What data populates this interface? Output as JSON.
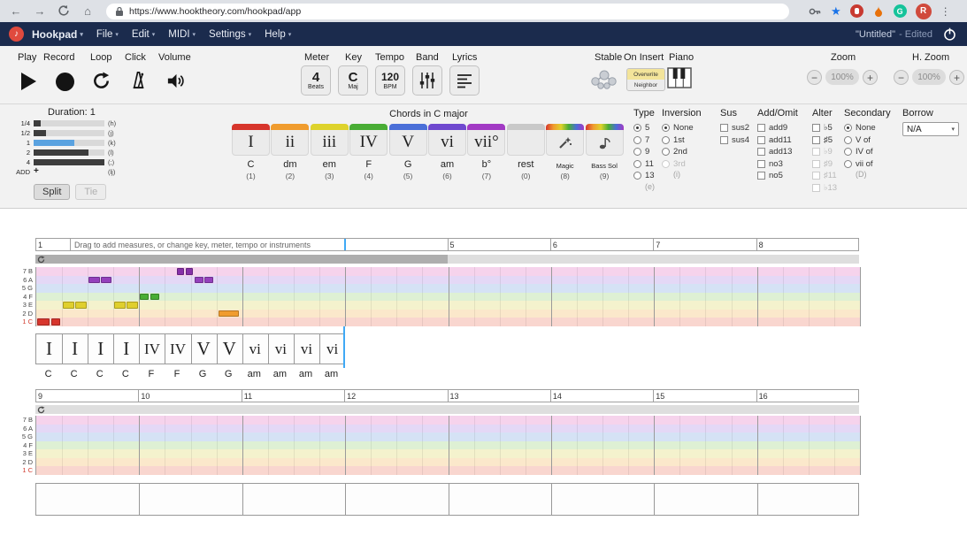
{
  "browser": {
    "url": "https://www.hooktheory.com/hookpad/app",
    "avatar_letter": "R",
    "bookmark_color": "#1a73e8"
  },
  "header": {
    "menus": [
      "Hookpad",
      "File",
      "Edit",
      "MIDI",
      "Settings",
      "Help"
    ],
    "doc_title": "\"Untitled\"",
    "doc_status": "- Edited"
  },
  "transport": {
    "play": "Play",
    "record": "Record",
    "loop": "Loop",
    "click": "Click",
    "volume": "Volume"
  },
  "settings": {
    "meter": {
      "label": "Meter",
      "value": "4",
      "unit": "Beats"
    },
    "key": {
      "label": "Key",
      "value": "C",
      "unit": "Maj"
    },
    "tempo": {
      "label": "Tempo",
      "value": "120",
      "unit": "BPM"
    },
    "band": {
      "label": "Band"
    },
    "lyrics": {
      "label": "Lyrics"
    },
    "stable": {
      "label": "Stable"
    },
    "on_insert": {
      "label": "On Insert",
      "options": [
        "Overwrite",
        "Neighbor"
      ],
      "selected": "Overwrite"
    },
    "piano": {
      "label": "Piano"
    },
    "zoom": {
      "label": "Zoom",
      "value": "100%"
    },
    "h_zoom": {
      "label": "H. Zoom",
      "value": "100%"
    }
  },
  "duration": {
    "title": "Duration: 1",
    "selected_color": "#5aa2e0",
    "bar_color": "#3d3d3d",
    "rows": [
      {
        "label": "1/4",
        "key": "(h)",
        "fill": 8
      },
      {
        "label": "1/2",
        "key": "(j)",
        "fill": 14
      },
      {
        "label": "1",
        "key": "(k)",
        "fill": 46,
        "selected": true
      },
      {
        "label": "2",
        "key": "(l)",
        "fill": 62
      },
      {
        "label": "4",
        "key": "(;)",
        "fill": 80
      },
      {
        "label": "ADD",
        "key": "(lj)",
        "fill": 0,
        "add": true
      }
    ],
    "split": "Split",
    "tie": "Tie"
  },
  "palette": {
    "title": "Chords in C major",
    "chords": [
      {
        "numeral": "I",
        "name": "C",
        "num": "(1)",
        "color": "#d7352c"
      },
      {
        "numeral": "ii",
        "name": "dm",
        "num": "(2)",
        "color": "#f09c2e"
      },
      {
        "numeral": "iii",
        "name": "em",
        "num": "(3)",
        "color": "#ded32c"
      },
      {
        "numeral": "IV",
        "name": "F",
        "num": "(4)",
        "color": "#49ad35"
      },
      {
        "numeral": "V",
        "name": "G",
        "num": "(5)",
        "color": "#4a6fd8"
      },
      {
        "numeral": "vi",
        "name": "am",
        "num": "(6)",
        "color": "#6f49cf"
      },
      {
        "numeral": "vii°",
        "name": "b°",
        "num": "(7)",
        "color": "#a23ac4"
      },
      {
        "numeral": "",
        "name": "rest",
        "num": "(0)",
        "color": "#c9c9c9"
      },
      {
        "numeral": "",
        "name": "Magic",
        "num": "(8)",
        "color": "rainbow",
        "icon": "magic"
      },
      {
        "numeral": "",
        "name": "Bass Sol",
        "num": "(9)",
        "color": "rainbow",
        "icon": "bass"
      }
    ]
  },
  "options": {
    "type": {
      "label": "Type",
      "hint": "(e)",
      "items": [
        {
          "t": "5",
          "sel": true
        },
        {
          "t": "7"
        },
        {
          "t": "9"
        },
        {
          "t": "11"
        },
        {
          "t": "13"
        }
      ]
    },
    "inversion": {
      "label": "Inversion",
      "hint": "(i)",
      "items": [
        {
          "t": "None",
          "sel": true
        },
        {
          "t": "1st"
        },
        {
          "t": "2nd"
        },
        {
          "t": "3rd",
          "dis": true
        }
      ]
    },
    "sus": {
      "label": "Sus",
      "items": [
        {
          "t": "sus2"
        },
        {
          "t": "sus4"
        }
      ]
    },
    "add_omit": {
      "label": "Add/Omit",
      "items": [
        {
          "t": "add9"
        },
        {
          "t": "add11"
        },
        {
          "t": "add13"
        },
        {
          "t": "no3"
        },
        {
          "t": "no5"
        }
      ]
    },
    "alter": {
      "label": "Alter",
      "items": [
        {
          "t": "♭5"
        },
        {
          "t": "♯5"
        },
        {
          "t": "♭9",
          "dis": true
        },
        {
          "t": "♯9",
          "dis": true
        },
        {
          "t": "♯11",
          "dis": true
        },
        {
          "t": "♭13",
          "dis": true
        }
      ]
    },
    "secondary": {
      "label": "Secondary",
      "hint": "(D)",
      "items": [
        {
          "t": "None",
          "sel": true
        },
        {
          "t": "V of"
        },
        {
          "t": "IV of"
        },
        {
          "t": "vii of"
        }
      ]
    },
    "borrow": {
      "label": "Borrow",
      "value": "N/A"
    }
  },
  "score": {
    "hint": "Drag to add measures, or change key, meter, tempo or instruments",
    "row_labels": [
      "7 B",
      "6 A",
      "5 G",
      "4 F",
      "3 E",
      "2 D",
      "1 C"
    ],
    "row_colors": [
      "#f6d3ec",
      "#e4d8f6",
      "#d5e2f5",
      "#def0d4",
      "#f4f2cd",
      "#fbe8cb",
      "#f9d6cf"
    ],
    "degree_colors": {
      "1": "#d7352c",
      "2": "#f09c2e",
      "3": "#e0cf2e",
      "4": "#49ad35",
      "5": "#4a6fd8",
      "6": "#9440bc",
      "7": "#8731a8"
    },
    "cursor_color": "#3fa9f5",
    "system1": {
      "numbers": [
        [
          "1",
          0
        ],
        [
          "5",
          4
        ],
        [
          "6",
          5
        ],
        [
          "7",
          6
        ],
        [
          "8",
          7
        ]
      ]
    },
    "system2": {
      "numbers": [
        [
          "9",
          0
        ],
        [
          "10",
          1
        ],
        [
          "11",
          2
        ],
        [
          "12",
          3
        ],
        [
          "13",
          4
        ],
        [
          "14",
          5
        ],
        [
          "15",
          6
        ],
        [
          "16",
          7
        ]
      ]
    },
    "notes": [
      {
        "row": "C",
        "deg": 1,
        "start": 0,
        "dur": 0.55
      },
      {
        "row": "C",
        "deg": 1,
        "start": 0.55,
        "dur": 0.4
      },
      {
        "row": "E",
        "deg": 3,
        "start": 1.0,
        "dur": 0.5
      },
      {
        "row": "E",
        "deg": 3,
        "start": 1.5,
        "dur": 0.5
      },
      {
        "row": "A",
        "deg": 6,
        "start": 2.0,
        "dur": 0.5
      },
      {
        "row": "A",
        "deg": 6,
        "start": 2.5,
        "dur": 0.45
      },
      {
        "row": "E",
        "deg": 3,
        "start": 3.0,
        "dur": 0.5
      },
      {
        "row": "E",
        "deg": 3,
        "start": 3.5,
        "dur": 0.5
      },
      {
        "row": "F",
        "deg": 4,
        "start": 4.0,
        "dur": 0.4
      },
      {
        "row": "F",
        "deg": 4,
        "start": 4.4,
        "dur": 0.4
      },
      {
        "row": "B",
        "deg": 7,
        "start": 5.45,
        "dur": 0.33
      },
      {
        "row": "B",
        "deg": 7,
        "start": 5.78,
        "dur": 0.33
      },
      {
        "row": "A",
        "deg": 6,
        "start": 6.12,
        "dur": 0.4
      },
      {
        "row": "A",
        "deg": 6,
        "start": 6.52,
        "dur": 0.4
      },
      {
        "row": "D",
        "deg": 2,
        "start": 7.05,
        "dur": 0.85
      }
    ],
    "chords": [
      {
        "n": "I",
        "l": "C"
      },
      {
        "n": "I",
        "l": "C"
      },
      {
        "n": "I",
        "l": "C"
      },
      {
        "n": "I",
        "l": "C"
      },
      {
        "n": "IV",
        "l": "F"
      },
      {
        "n": "IV",
        "l": "F"
      },
      {
        "n": "V",
        "l": "G"
      },
      {
        "n": "V",
        "l": "G"
      },
      {
        "n": "vi",
        "l": "am"
      },
      {
        "n": "vi",
        "l": "am"
      },
      {
        "n": "vi",
        "l": "am"
      },
      {
        "n": "vi",
        "l": "am"
      }
    ]
  }
}
